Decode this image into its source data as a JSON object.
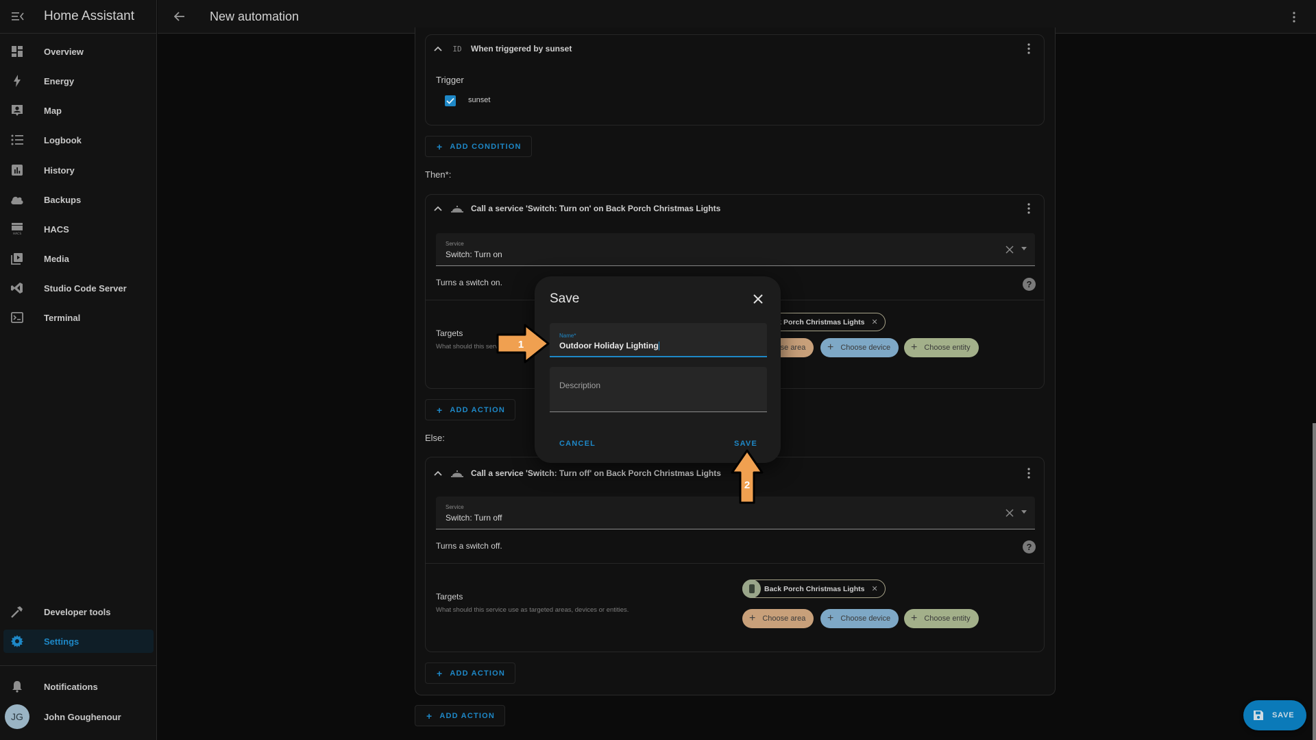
{
  "app": {
    "title": "Home Assistant"
  },
  "header": {
    "title": "New automation"
  },
  "sidebar": {
    "items": [
      {
        "label": "Overview",
        "icon": "view-dashboard-icon"
      },
      {
        "label": "Energy",
        "icon": "lightning-bolt-icon"
      },
      {
        "label": "Map",
        "icon": "map-account-icon"
      },
      {
        "label": "Logbook",
        "icon": "format-list-bulleted-icon"
      },
      {
        "label": "History",
        "icon": "chart-box-icon"
      },
      {
        "label": "Backups",
        "icon": "cloud-icon"
      },
      {
        "label": "HACS",
        "icon": "hacs-store-icon"
      },
      {
        "label": "Media",
        "icon": "play-box-multiple-icon"
      },
      {
        "label": "Studio Code Server",
        "icon": "vscode-icon"
      },
      {
        "label": "Terminal",
        "icon": "console-icon"
      }
    ],
    "bottom_items": [
      {
        "label": "Developer tools",
        "icon": "hammer-icon"
      },
      {
        "label": "Settings",
        "icon": "cog-icon",
        "active": true
      }
    ],
    "notifications": {
      "label": "Notifications",
      "icon": "bell-icon"
    },
    "user": {
      "initials": "JG",
      "name": "John Goughenour"
    }
  },
  "trigger_card": {
    "id_badge": "ID",
    "title": "When triggered by sunset",
    "trigger_label": "Trigger",
    "checkbox_label": "sunset",
    "checked": true
  },
  "add_condition_label": "ADD CONDITION",
  "then_label": "Then*:",
  "else_label": "Else:",
  "then_action": {
    "title": "Call a service 'Switch: Turn on' on Back Porch Christmas Lights",
    "service_label": "Service",
    "service_value": "Switch: Turn on",
    "service_description": "Turns a switch on.",
    "targets_title": "Targets",
    "targets_subtitle": "What should this service use as targeted areas, devices or entities.",
    "entity_chip": "Back Porch Christmas Lights",
    "choose_area": "Choose area",
    "choose_device": "Choose device",
    "choose_entity": "Choose entity"
  },
  "else_action": {
    "title": "Call a service 'Switch: Turn off' on Back Porch Christmas Lights",
    "service_label": "Service",
    "service_value": "Switch: Turn off",
    "service_description": "Turns a switch off.",
    "targets_title": "Targets",
    "targets_subtitle": "What should this service use as targeted areas, devices or entities.",
    "entity_chip": "Back Porch Christmas Lights",
    "choose_area": "Choose area",
    "choose_device": "Choose device",
    "choose_entity": "Choose entity"
  },
  "add_action_label": "ADD ACTION",
  "dialog": {
    "title": "Save",
    "name_label": "Name*",
    "name_value": "Outdoor Holiday Lighting",
    "description_placeholder": "Description",
    "cancel_label": "CANCEL",
    "save_label": "SAVE"
  },
  "annotations": {
    "step1": "1",
    "step2": "2",
    "color": "#f0a050"
  },
  "fab": {
    "label": "SAVE"
  },
  "colors": {
    "accent": "#1e88c7",
    "area_chip": "#c8a07a",
    "device_chip": "#7ea8c6",
    "entity_chip": "#a3b08a"
  }
}
